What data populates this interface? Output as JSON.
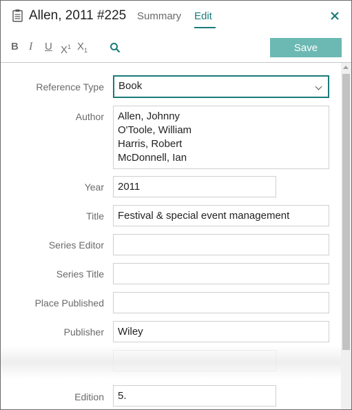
{
  "header": {
    "reference_title": "Allen, 2011 #225",
    "tabs": [
      {
        "label": "Summary",
        "active": false
      },
      {
        "label": "Edit",
        "active": true
      }
    ],
    "close_icon": "close-icon",
    "accent_color": "#1a7a7a"
  },
  "toolbar": {
    "bold": "B",
    "italic": "I",
    "underline": "U",
    "superscript": "X",
    "superscript_mark": "1",
    "subscript": "X",
    "subscript_mark": "1",
    "search_icon": "search-icon",
    "save_label": "Save",
    "save_color": "#6cb9b3"
  },
  "form": {
    "reference_type": {
      "label": "Reference Type",
      "value": "Book"
    },
    "author": {
      "label": "Author",
      "values": [
        "Allen, Johnny",
        "O'Toole, William",
        "Harris, Robert",
        "McDonnell, Ian"
      ]
    },
    "year": {
      "label": "Year",
      "value": "2011"
    },
    "title": {
      "label": "Title",
      "value": "Festival & special event management"
    },
    "series_editor": {
      "label": "Series Editor",
      "value": ""
    },
    "series_title": {
      "label": "Series Title",
      "value": ""
    },
    "place_published": {
      "label": "Place Published",
      "value": ""
    },
    "publisher": {
      "label": "Publisher",
      "value": "Wiley"
    },
    "edition": {
      "label": "Edition",
      "value": "5."
    }
  }
}
